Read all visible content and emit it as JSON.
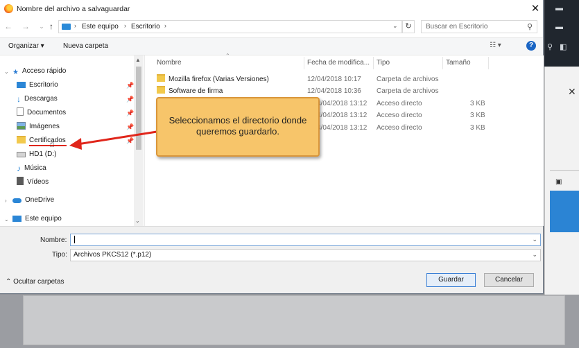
{
  "window": {
    "title": "Nombre del archivo a salvaguardar",
    "close_glyph": "✕"
  },
  "nav": {
    "back": "←",
    "forward": "→",
    "up": "↑"
  },
  "address": {
    "segments": [
      "Este equipo",
      "Escritorio"
    ],
    "separator": "›"
  },
  "search": {
    "placeholder": "Buscar en Escritorio"
  },
  "toolbar": {
    "organize": "Organizar ▾",
    "new_folder": "Nueva carpeta",
    "help": "?"
  },
  "sidebar": {
    "quick_access": "Acceso rápido",
    "items": [
      {
        "label": "Escritorio",
        "icon": "desktop-icon"
      },
      {
        "label": "Descargas",
        "icon": "download-icon"
      },
      {
        "label": "Documentos",
        "icon": "document-icon"
      },
      {
        "label": "Imágenes",
        "icon": "image-icon"
      },
      {
        "label": "Certificados",
        "icon": "folder-icon"
      },
      {
        "label": "HD1 (D:)",
        "icon": "drive-icon"
      },
      {
        "label": "Música",
        "icon": "music-icon"
      },
      {
        "label": "Vídeos",
        "icon": "video-icon"
      }
    ],
    "onedrive": "OneDrive",
    "this_pc": "Este equipo"
  },
  "columns": {
    "name": "Nombre",
    "date": "Fecha de modifica...",
    "type": "Tipo",
    "size": "Tamaño"
  },
  "files": [
    {
      "name": "Mozilla firefox (Varias Versiones)",
      "date": "12/04/2018 10:17",
      "type": "Carpeta de archivos",
      "size": ""
    },
    {
      "name": "Software de firma",
      "date": "12/04/2018 10:36",
      "type": "Carpeta de archivos",
      "size": ""
    },
    {
      "name": "",
      "date": "4/04/2018 13:12",
      "type": "Acceso directo",
      "size": "3 KB"
    },
    {
      "name": "",
      "date": "4/04/2018 13:12",
      "type": "Acceso directo",
      "size": "3 KB"
    },
    {
      "name": "",
      "date": "4/04/2018 13:12",
      "type": "Acceso directo",
      "size": "3 KB"
    }
  ],
  "form": {
    "name_label": "Nombre:",
    "name_value": "",
    "type_label": "Tipo:",
    "type_value": "Archivos PKCS12 (*.p12)",
    "hide_folders": "⌃ Ocultar carpetas",
    "save": "Guardar",
    "cancel": "Cancelar"
  },
  "callout": {
    "text": "Seleccionamos el directorio donde queremos guardarlo."
  },
  "colors": {
    "callout_fill": "#f7c56a",
    "arrow": "#e0261b",
    "accent": "#1a65c4"
  }
}
